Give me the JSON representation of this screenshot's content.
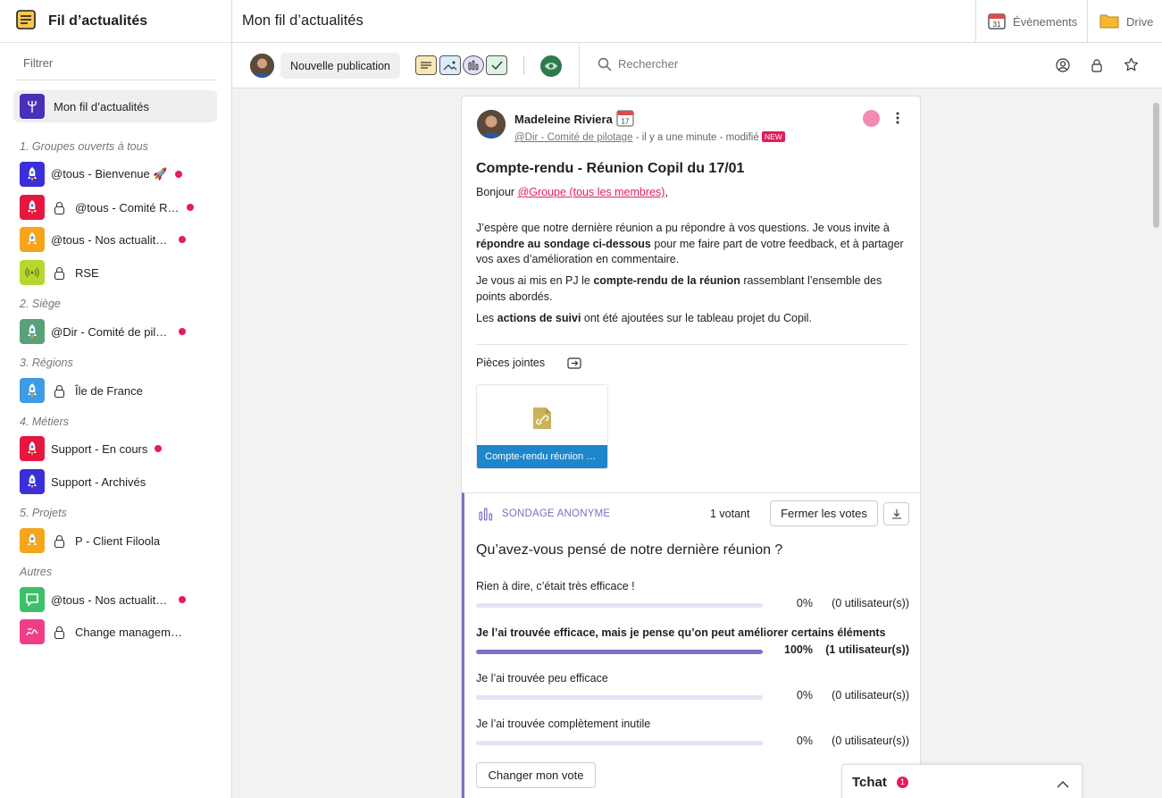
{
  "sidebar": {
    "title": "Fil d’actualités",
    "filter_placeholder": "Filtrer",
    "active_item": "Mon fil d’actualités",
    "sections": [
      {
        "title": "1. Groupes ouverts à tous",
        "items": [
          {
            "label": "@tous - Bienvenue 🚀",
            "locked": false,
            "unread": true
          },
          {
            "label": "@tous - Comité R…",
            "locked": true,
            "unread": true
          },
          {
            "label": "@tous - Nos actualité…",
            "locked": false,
            "unread": true
          },
          {
            "label": "RSE",
            "locked": true,
            "unread": false
          }
        ]
      },
      {
        "title": "2. Siège",
        "items": [
          {
            "label": "@Dir - Comité de pilot…",
            "locked": false,
            "unread": true
          }
        ]
      },
      {
        "title": "3. Régions",
        "items": [
          {
            "label": "Île de France",
            "locked": true,
            "unread": false
          }
        ]
      },
      {
        "title": "4. Métiers",
        "items": [
          {
            "label": "Support - En cours",
            "locked": false,
            "unread": true
          },
          {
            "label": "Support - Archivés",
            "locked": false,
            "unread": false
          }
        ]
      },
      {
        "title": "5. Projets",
        "items": [
          {
            "label": "P - Client Filoola",
            "locked": true,
            "unread": false
          }
        ]
      },
      {
        "title": "Autres",
        "items": [
          {
            "label": "@tous - Nos actualité…",
            "locked": false,
            "unread": true
          },
          {
            "label": "Change management",
            "locked": true,
            "unread": false
          }
        ]
      }
    ]
  },
  "header": {
    "title": "Mon fil d’actualités",
    "events_label": "Évènements",
    "drive_label": "Drive",
    "calendar_day": "31"
  },
  "toolbar": {
    "new_post_label": "Nouvelle publication",
    "search_placeholder": "Rechercher"
  },
  "post": {
    "author": "Madeleine Riviera",
    "calendar_day": "17",
    "group_link": "@Dir - Comité de pilotage",
    "time": "- il y a une minute",
    "modified": "- modifié",
    "new_badge": "NEW",
    "title": "Compte-rendu - Réunion Copil du 17/01",
    "greeting": "Bonjour",
    "mention": "@Groupe (tous les membres)",
    "greeting_end": ",",
    "p1_a": "J’espère que notre dernière réunion a pu répondre à vos questions. Je vous invite à ",
    "p1_b": "répondre au sondage ci-dessous",
    "p1_c": " pour me faire part de votre feedback, et à partager vos axes d’amélioration en commentaire.",
    "p2_a": "Je vous ai mis en PJ le ",
    "p2_b": "compte-rendu de la réunion",
    "p2_c": " rassemblant l’ensemble des points abordés.",
    "p3_a": "Les ",
    "p3_b": "actions de suivi",
    "p3_c": " ont été ajoutées sur le tableau projet du Copil.",
    "attachments_label": "Pièces jointes",
    "attachment_name": "Compte-rendu réunion …"
  },
  "poll": {
    "tag": "SONDAGE ANONYME",
    "voters": "1 votant",
    "close_label": "Fermer les votes",
    "question": "Qu’avez-vous pensé de notre dernière réunion ?",
    "options": [
      {
        "label": "Rien à dire, c’était très efficace !",
        "percent": 0,
        "percent_text": "0%",
        "count": "(0 utilisateur(s))",
        "selected": false
      },
      {
        "label": "Je l’ai trouvée efficace, mais je pense qu’on peut améliorer certains éléments",
        "percent": 100,
        "percent_text": "100%",
        "count": "(1 utilisateur(s))",
        "selected": true
      },
      {
        "label": "Je l’ai trouvée peu efficace",
        "percent": 0,
        "percent_text": "0%",
        "count": "(0 utilisateur(s))",
        "selected": false
      },
      {
        "label": "Je l’ai trouvée complètement inutile",
        "percent": 0,
        "percent_text": "0%",
        "count": "(0 utilisateur(s))",
        "selected": false
      }
    ],
    "change_vote_label": "Changer mon vote"
  },
  "chat": {
    "label": "Tchat",
    "badge": "1"
  },
  "colors": {
    "accent": "#7f6ec4",
    "notification": "#e41d5a",
    "attachment": "#1e87cc"
  }
}
